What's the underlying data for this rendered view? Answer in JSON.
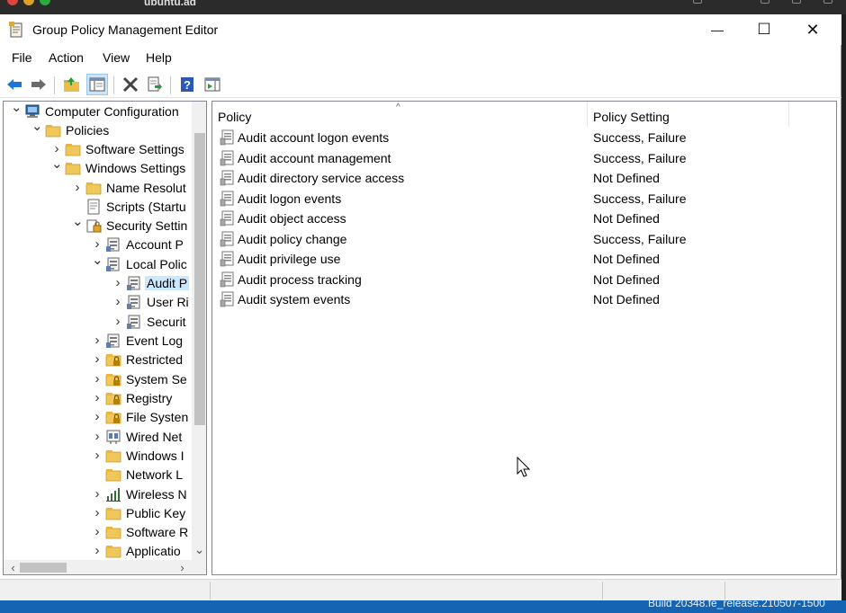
{
  "window": {
    "title": "Group Policy Management Editor",
    "controls": {
      "minimize": "—",
      "maximize": "☐",
      "close": "✕"
    }
  },
  "menu": [
    "File",
    "Action",
    "View",
    "Help"
  ],
  "toolbar": {
    "buttons": [
      {
        "name": "back-icon"
      },
      {
        "name": "forward-icon"
      },
      {
        "name": "up-folder-icon"
      },
      {
        "name": "show-hide-tree-icon"
      },
      {
        "name": "delete-icon"
      },
      {
        "name": "export-list-icon"
      },
      {
        "name": "help-icon"
      },
      {
        "name": "show-action-pane-icon"
      }
    ],
    "colors": {
      "arrow": "#1e78d2",
      "help": "#2b57b8"
    }
  },
  "tree": [
    {
      "label": "Computer Configuration",
      "level": 0,
      "twisty": "open",
      "icon": "computer-icon"
    },
    {
      "label": "Policies",
      "level": 1,
      "twisty": "open",
      "icon": "folder-icon"
    },
    {
      "label": "Software Settings",
      "level": 2,
      "twisty": "closed",
      "icon": "folder-icon"
    },
    {
      "label": "Windows Settings",
      "level": 2,
      "twisty": "open",
      "icon": "folder-icon"
    },
    {
      "label": "Name Resolut",
      "level": 3,
      "twisty": "closed",
      "icon": "folder-icon"
    },
    {
      "label": "Scripts (Startu",
      "level": 3,
      "twisty": "none",
      "icon": "script-icon"
    },
    {
      "label": "Security Settin",
      "level": 3,
      "twisty": "open",
      "icon": "security-icon"
    },
    {
      "label": "Account P",
      "level": 4,
      "twisty": "closed",
      "icon": "policy-folder-icon"
    },
    {
      "label": "Local Polic",
      "level": 4,
      "twisty": "open",
      "icon": "policy-folder-icon"
    },
    {
      "label": "Audit P",
      "level": 5,
      "twisty": "closed",
      "icon": "policy-folder-icon",
      "selected": true
    },
    {
      "label": "User Ri",
      "level": 5,
      "twisty": "closed",
      "icon": "policy-folder-icon"
    },
    {
      "label": "Securit",
      "level": 5,
      "twisty": "closed",
      "icon": "policy-folder-icon"
    },
    {
      "label": "Event Log",
      "level": 4,
      "twisty": "closed",
      "icon": "policy-folder-icon"
    },
    {
      "label": "Restricted",
      "level": 4,
      "twisty": "closed",
      "icon": "lock-folder-icon"
    },
    {
      "label": "System Se",
      "level": 4,
      "twisty": "closed",
      "icon": "lock-folder-icon"
    },
    {
      "label": "Registry",
      "level": 4,
      "twisty": "closed",
      "icon": "lock-folder-icon"
    },
    {
      "label": "File Systen",
      "level": 4,
      "twisty": "closed",
      "icon": "lock-folder-icon"
    },
    {
      "label": "Wired Net",
      "level": 4,
      "twisty": "closed",
      "icon": "network-icon"
    },
    {
      "label": "Windows I",
      "level": 4,
      "twisty": "closed",
      "icon": "folder-icon"
    },
    {
      "label": "Network L",
      "level": 4,
      "twisty": "none",
      "icon": "folder-icon"
    },
    {
      "label": "Wireless N",
      "level": 4,
      "twisty": "closed",
      "icon": "wireless-icon"
    },
    {
      "label": "Public Key",
      "level": 4,
      "twisty": "closed",
      "icon": "folder-icon"
    },
    {
      "label": "Software R",
      "level": 4,
      "twisty": "closed",
      "icon": "folder-icon"
    },
    {
      "label": "Applicatio",
      "level": 4,
      "twisty": "closed",
      "icon": "folder-icon"
    }
  ],
  "list": {
    "columns": [
      "Policy",
      "Policy Setting"
    ],
    "sort_indicator": "^",
    "rows": [
      {
        "policy": "Audit account logon events",
        "setting": "Success, Failure"
      },
      {
        "policy": "Audit account management",
        "setting": "Success, Failure"
      },
      {
        "policy": "Audit directory service access",
        "setting": "Not Defined"
      },
      {
        "policy": "Audit logon events",
        "setting": "Success, Failure"
      },
      {
        "policy": "Audit object access",
        "setting": "Not Defined"
      },
      {
        "policy": "Audit policy change",
        "setting": "Success, Failure"
      },
      {
        "policy": "Audit privilege use",
        "setting": "Not Defined"
      },
      {
        "policy": "Audit process tracking",
        "setting": "Not Defined"
      },
      {
        "policy": "Audit system events",
        "setting": "Not Defined"
      }
    ]
  },
  "host": {
    "title": "ubuntu.ad",
    "taskbar_text": "Build 20348.fe_release.210507-1500"
  },
  "scroll": {
    "vertical_arrow_down": "⌄",
    "horizontal_left": "‹",
    "horizontal_right": "›"
  }
}
